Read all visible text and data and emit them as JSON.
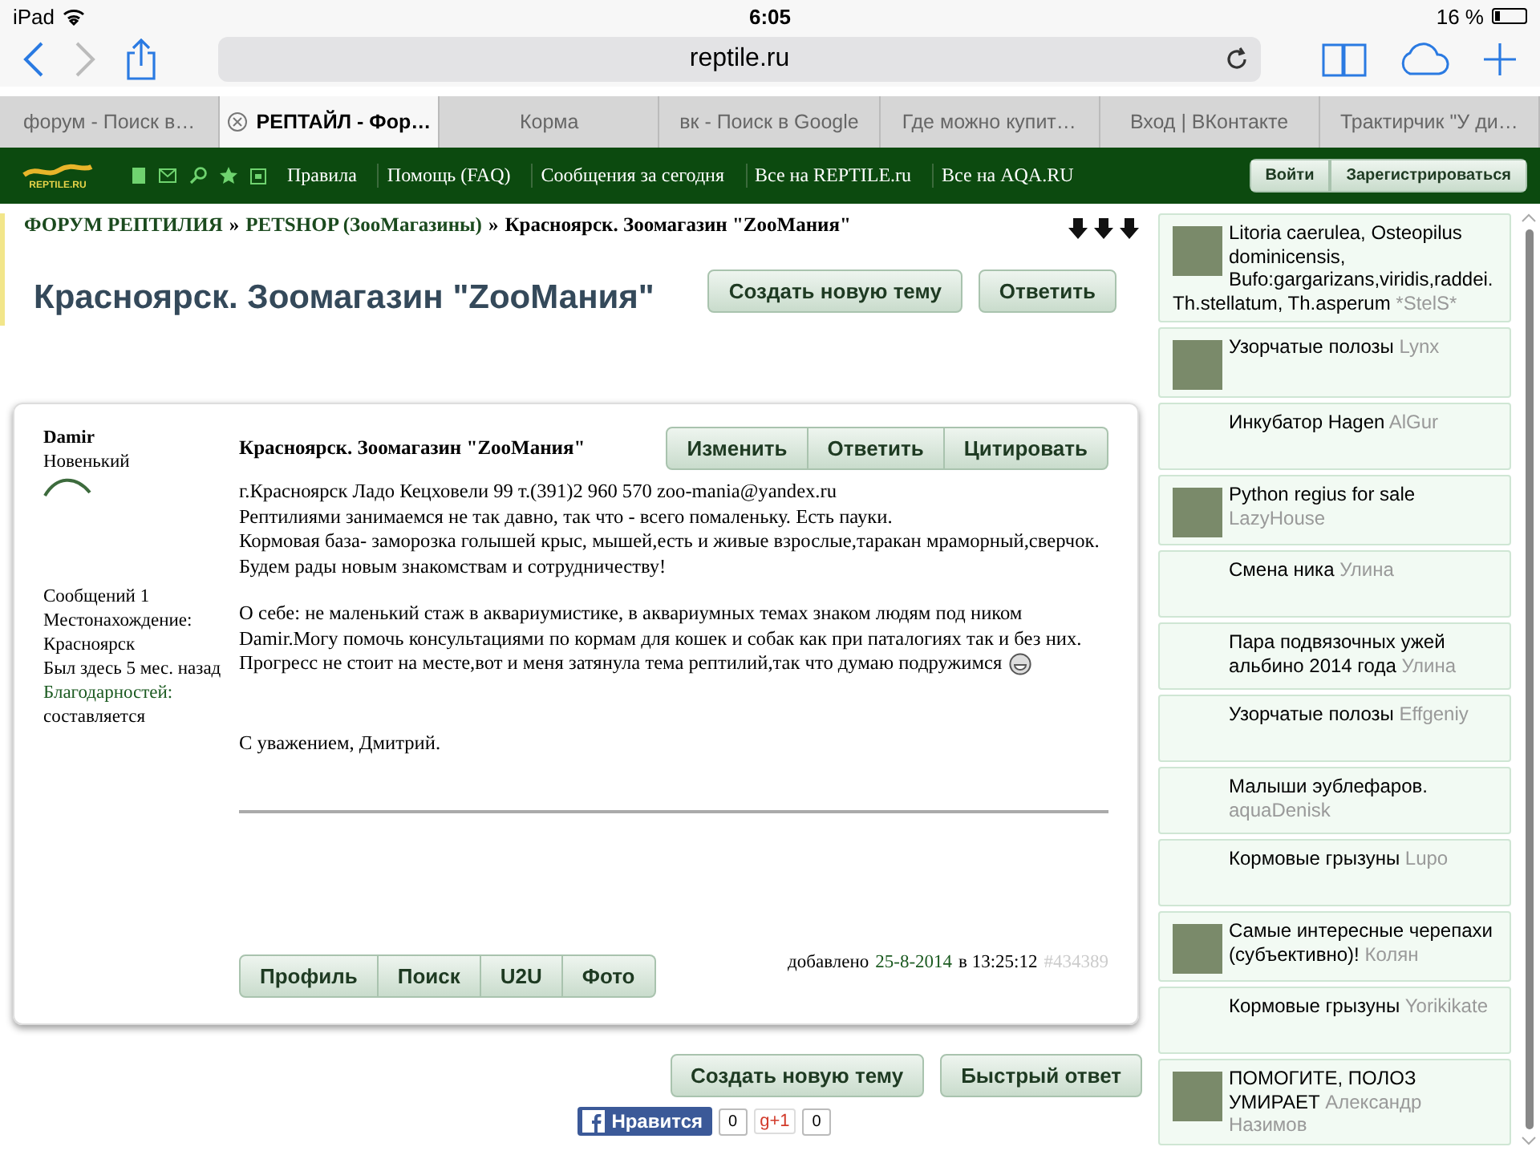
{
  "status_bar": {
    "device": "iPad",
    "time": "6:05",
    "battery": "16 %"
  },
  "toolbar": {
    "url": "reptile.ru"
  },
  "tabs": [
    {
      "label": "форум - Поиск в…",
      "selected": false
    },
    {
      "label": "РЕПТАЙЛ - Фор…",
      "selected": true
    },
    {
      "label": "Корма",
      "selected": false
    },
    {
      "label": "вк - Поиск в Google",
      "selected": false
    },
    {
      "label": "Где можно купит…",
      "selected": false
    },
    {
      "label": "Вход | ВКонтакте",
      "selected": false
    },
    {
      "label": "Трактирчик \"У ди…",
      "selected": false
    }
  ],
  "site_nav": {
    "logo_text": "REPTILE.RU",
    "links": [
      "Правила",
      "Помощь (FAQ)",
      "Сообщения за сегодня",
      "Все на REPTILE.ru",
      "Все на AQA.RU"
    ],
    "buttons": [
      "Войти",
      "Зарегистрироваться"
    ]
  },
  "breadcrumb": [
    {
      "label": "ФОРУМ РЕПТИЛИЯ",
      "kind": "link"
    },
    {
      "label": "»",
      "kind": "separator"
    },
    {
      "label": "PETSHOP (ЗооМагазины)",
      "kind": "link"
    },
    {
      "label": "»",
      "kind": "separator"
    },
    {
      "label": "Красноярск. Зоомагазин \"ZooМания\"",
      "kind": "current"
    }
  ],
  "topic": {
    "title": "Красноярск. Зоомагазин \"ZooМания\"",
    "buttons": [
      "Создать новую тему",
      "Ответить"
    ]
  },
  "post": {
    "author": {
      "name": "Damir",
      "rank": "Новенький",
      "stats": [
        {
          "text": "Сообщений 1",
          "kind": "plain"
        },
        {
          "text": "Местонахождение:",
          "kind": "plain"
        },
        {
          "text": "Красноярск",
          "kind": "plain"
        },
        {
          "text": "Был здесь 5 мес. назад",
          "kind": "plain"
        },
        {
          "text": "Благодарностей:",
          "kind": "link"
        },
        {
          "text": "составляется",
          "kind": "plain"
        }
      ]
    },
    "title": "Красноярск. Зоомагазин \"ZooМания\"",
    "actions": [
      "Изменить",
      "Ответить",
      "Цитировать"
    ],
    "paragraphs": [
      {
        "lines": [
          "г.Красноярск Ладо Кецховели 99 т.(391)2 960 570 zoo-mania@yandex.ru",
          "Рептилиями занимаемся не так давно, так что - всего помаленьку. Есть пауки.",
          "Кормовая база- заморозка голышей крыс, мышей,есть и живые взрослые,таракан мраморный,сверчок.",
          "Будем рады новым знакомствам и сотрудничеству!"
        ],
        "smiley": false
      },
      {
        "lines": [
          "О себе: не маленький стаж в аквариумистике, в аквариумных темах знаком людям под ником Damir.Могу помочь консультациями по кормам для кошек и собак как при паталогиях так и без них. Прогресс не стоит на месте,вот и меня затянула тема рептилий,так что думаю подружимся"
        ],
        "smiley": true
      }
    ],
    "signature": "С уважением, Дмитрий.",
    "footer_buttons": [
      "Профиль",
      "Поиск",
      "U2U",
      "Фото"
    ],
    "added": {
      "label": "добавлено",
      "date": "25-8-2014",
      "time": "в 13:25:12",
      "number": "#434389"
    }
  },
  "bottom_buttons": [
    "Создать новую тему",
    "Быстрый ответ"
  ],
  "social": {
    "like_label": "Нравится",
    "like_count": "0",
    "plus_label": "g+1",
    "plus_count": "0"
  },
  "sidebar": {
    "topics": [
      {
        "title": "Litoria caerulea, Osteopilus dominicensis, Bufo:gargarizans,viridis,raddei. Th.stellatum, Th.asperum",
        "author": "*StelS*",
        "avatar": true
      },
      {
        "title": "Узорчатые полозы",
        "author": "Lynx",
        "avatar": true
      },
      {
        "title": "Инкубатор Hagen",
        "author": "AlGur",
        "avatar": false
      },
      {
        "title": "Python regius for sale",
        "author": "LazyHouse",
        "avatar": true
      },
      {
        "title": "Смена ника",
        "author": "Улина",
        "avatar": false
      },
      {
        "title": "Пара подвязочных ужей альбино 2014 года",
        "author": "Улина",
        "avatar": false
      },
      {
        "title": "Узорчатые полозы",
        "author": "Effgeniy",
        "avatar": false
      },
      {
        "title": "Малыши эублефаров.",
        "author": "aquaDenisk",
        "avatar": false
      },
      {
        "title": "Кормовые грызуны",
        "author": "Lupo",
        "avatar": false
      },
      {
        "title": "Самые интересные черепахи (субъективно)!",
        "author": "Колян",
        "avatar": true
      },
      {
        "title": "Кормовые грызуны",
        "author": "Yorikikate",
        "avatar": false
      },
      {
        "title": "ПОМОГИТЕ, ПОЛОЗ УМИРАЕТ",
        "author": "Александр Назимов",
        "avatar": true
      }
    ]
  }
}
